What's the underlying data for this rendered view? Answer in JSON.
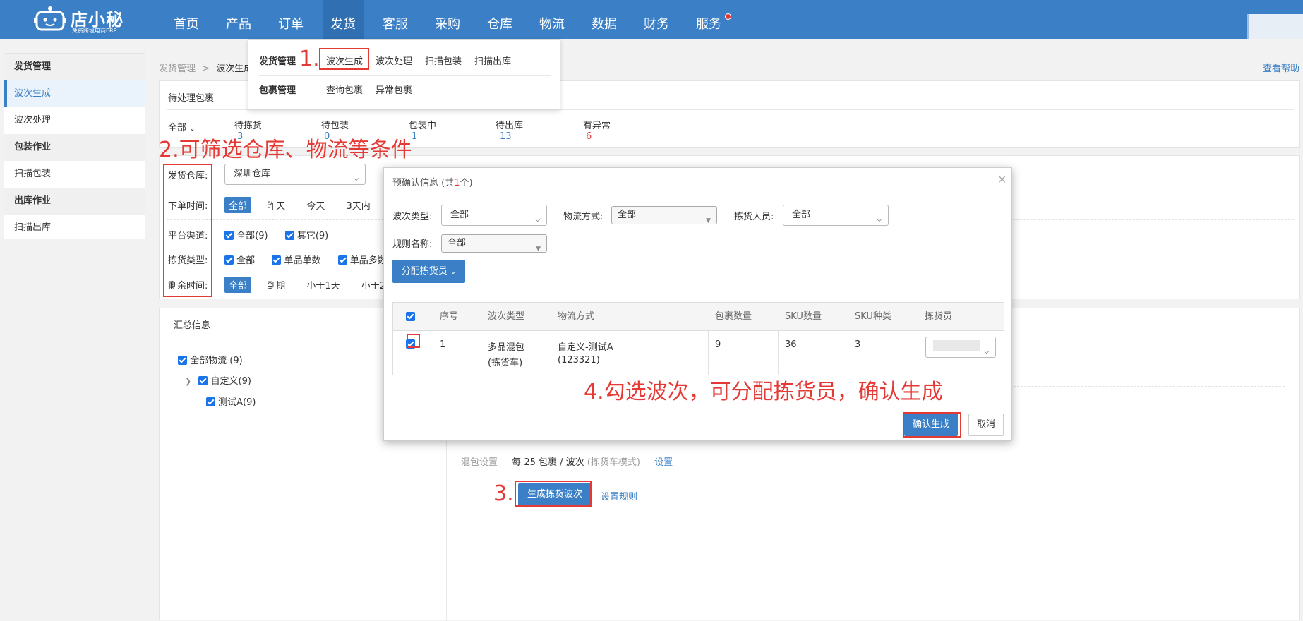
{
  "logo": {
    "name": "店小秘",
    "slogan": "免费跨境电商ERP"
  },
  "nav": [
    "首页",
    "产品",
    "订单",
    "发货",
    "客服",
    "采购",
    "仓库",
    "物流",
    "数据",
    "财务",
    "服务"
  ],
  "dropdown": {
    "group1_title": "发货管理",
    "group1_items": [
      "波次生成",
      "波次处理",
      "扫描包装",
      "扫描出库"
    ],
    "group2_title": "包裹管理",
    "group2_items": [
      "查询包裹",
      "异常包裹"
    ]
  },
  "sidebar": {
    "groups": [
      {
        "title": "发货管理",
        "items": [
          "波次生成",
          "波次处理"
        ]
      },
      {
        "title": "包装作业",
        "items": [
          "扫描包装"
        ]
      },
      {
        "title": "出库作业",
        "items": [
          "扫描出库"
        ]
      }
    ]
  },
  "breadcrumb": {
    "root": "发货管理",
    "sep": ">",
    "current": "波次生成"
  },
  "help_link": "查看帮助",
  "pending": {
    "title": "待处理包裹",
    "scope": "全部",
    "stats": [
      {
        "label": "待拣货",
        "value": "3"
      },
      {
        "label": "待包装",
        "value": "0"
      },
      {
        "label": "包装中",
        "value": "1"
      },
      {
        "label": "待出库",
        "value": "13"
      },
      {
        "label": "有异常",
        "value": "6"
      }
    ]
  },
  "filters": {
    "warehouse_label": "发货仓库:",
    "warehouse_value": "深圳仓库",
    "order_time_label": "下单时间:",
    "order_time_options": [
      "全部",
      "昨天",
      "今天",
      "3天内"
    ],
    "platform_label": "平台渠道:",
    "platform_options": [
      "全部(9)",
      "其它(9)"
    ],
    "pick_type_label": "拣货类型:",
    "pick_type_options": [
      "全部",
      "单品单数",
      "单品多数"
    ],
    "remain_label": "剩余时间:",
    "remain_options": [
      "全部",
      "到期",
      "小于1天",
      "小于2"
    ]
  },
  "summary": {
    "title": "汇总信息",
    "tree": [
      "全部物流 (9)",
      "自定义(9)",
      "测试A(9)"
    ]
  },
  "mix_setting": {
    "label": "混包设置",
    "each": "每",
    "count": "25",
    "unit": "包裹 / 波次",
    "mode": "(拣货车模式)",
    "setting_link": "设置"
  },
  "generate_button": "生成拣货波次",
  "rule_link": "设置规则",
  "modal": {
    "title_prefix": "预确认信息 (共",
    "title_count": "1",
    "title_suffix": "个)",
    "close": "×",
    "wave_type_label": "波次类型:",
    "wave_type_value": "全部",
    "logistics_label": "物流方式:",
    "logistics_value": "全部",
    "picker_label": "拣货人员:",
    "picker_value": "全部",
    "rule_label": "规则名称:",
    "rule_value": "全部",
    "assign_button": "分配拣货员",
    "columns": [
      "序号",
      "波次类型",
      "物流方式",
      "包裹数量",
      "SKU数量",
      "SKU种类",
      "拣货员"
    ],
    "row": {
      "index": "1",
      "wave_type": "多品混包",
      "wave_sub": "(拣货车)",
      "logistics": "自定义-测试A",
      "logistics_sub": "(123321)",
      "packages": "9",
      "sku_count": "36",
      "sku_types": "3"
    },
    "confirm_button": "确认生成",
    "cancel_button": "取消"
  },
  "annotations": {
    "a1": "1.",
    "a2": "2.可筛选仓库、物流等条件",
    "a3": "3.",
    "a4": "4.勾选波次，可分配拣货员，确认生成"
  },
  "colors": {
    "brand": "#3b80c6",
    "annotation": "#e53935"
  }
}
